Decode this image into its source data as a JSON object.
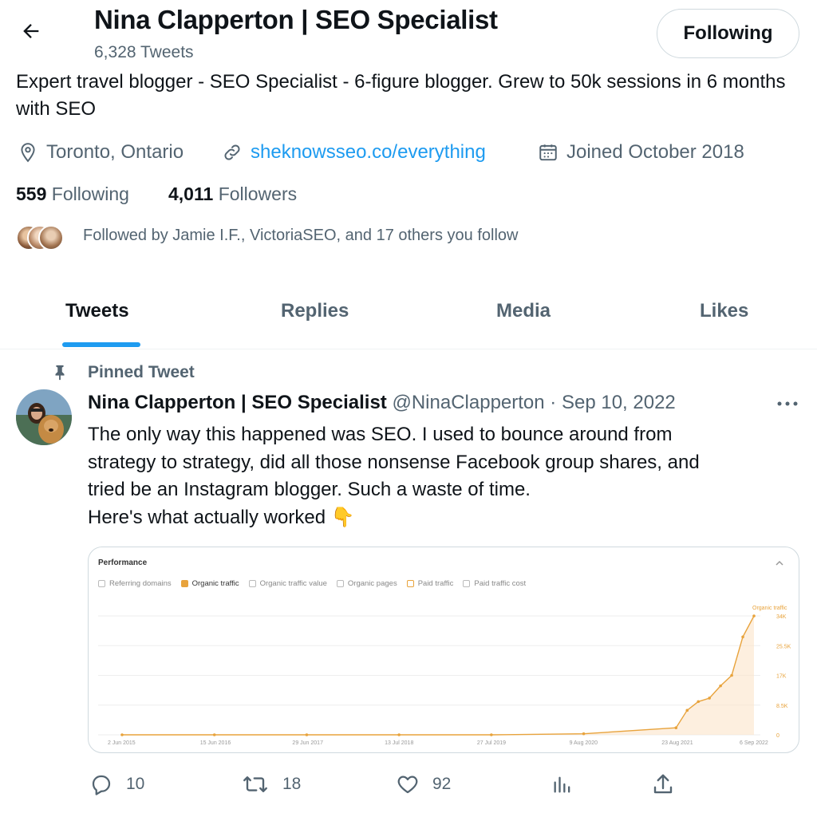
{
  "header": {
    "title": "Nina Clapperton | SEO Specialist",
    "tweet_count": "6,328 Tweets",
    "follow_button": "Following"
  },
  "profile": {
    "bio": "Expert travel blogger - SEO Specialist - 6-figure blogger. Grew to 50k sessions in 6 months with SEO",
    "location": "Toronto, Ontario",
    "website": "sheknowsseo.co/everything",
    "joined": "Joined October 2018",
    "following_count": "559",
    "following_label": "Following",
    "followers_count": "4,011",
    "followers_label": "Followers",
    "followed_by": "Followed by Jamie I.F., VictoriaSEO, and 17 others you follow"
  },
  "tabs": [
    {
      "label": "Tweets",
      "active": true
    },
    {
      "label": "Replies",
      "active": false
    },
    {
      "label": "Media",
      "active": false
    },
    {
      "label": "Likes",
      "active": false
    }
  ],
  "tweet": {
    "pinned_label": "Pinned Tweet",
    "author_name": "Nina Clapperton | SEO Specialist",
    "handle": "@NinaClapperton",
    "separator": "·",
    "date": "Sep 10, 2022",
    "text_lines": [
      "The only way this happened was SEO. I used to bounce around from",
      "strategy to strategy, did all those nonsense Facebook group shares, and",
      "tried be an Instagram blogger. Such a waste of time.",
      "Here's what actually worked 👇"
    ],
    "replies": "10",
    "retweets": "18",
    "likes": "92"
  },
  "media_chart": {
    "title": "Performance",
    "legend": [
      {
        "label": "Referring domains",
        "checked": false
      },
      {
        "label": "Organic traffic",
        "checked": true
      },
      {
        "label": "Organic traffic value",
        "checked": false
      },
      {
        "label": "Organic pages",
        "checked": false
      },
      {
        "label": "Paid traffic",
        "checked": false
      },
      {
        "label": "Paid traffic cost",
        "checked": false
      }
    ]
  },
  "chart_data": {
    "type": "area",
    "title": "Performance",
    "series": [
      {
        "name": "Organic traffic",
        "x": [
          "2 Jun 2015",
          "15 Jun 2016",
          "29 Jun 2017",
          "13 Jul 2018",
          "27 Jul 2019",
          "9 Aug 2020",
          "23 Aug 2021",
          "2022-02",
          "2022-04",
          "2022-05",
          "2022-06",
          "2022-07",
          "2022-08",
          "6 Sep 2022"
        ],
        "values": [
          0,
          0,
          0,
          0,
          0,
          300,
          2000,
          7000,
          9500,
          10500,
          14000,
          17000,
          28000,
          34000
        ]
      }
    ],
    "xtick_labels": [
      "2 Jun 2015",
      "15 Jun 2016",
      "29 Jun 2017",
      "13 Jul 2018",
      "27 Jul 2019",
      "9 Aug 2020",
      "23 Aug 2021",
      "6 Sep 2022"
    ],
    "ytick_labels": [
      "0",
      "8.5K",
      "17K",
      "25.5K",
      "34K"
    ],
    "ylim": [
      0,
      34000
    ],
    "series_label": "Organic traffic",
    "color": "#e8a33c",
    "grid": true
  },
  "colors": {
    "accent": "#1d9bf0",
    "muted": "#536471",
    "text": "#0f1419",
    "chart": "#e8a33c"
  }
}
